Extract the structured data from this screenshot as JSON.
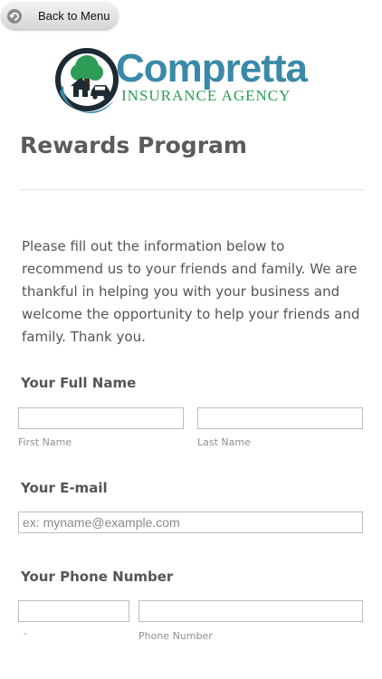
{
  "nav": {
    "back_label": "Back to Menu"
  },
  "logo": {
    "name": "Compretta",
    "tagline": "INSURANCE AGENCY"
  },
  "page": {
    "title": "Rewards Program",
    "intro": "Please fill out the information below to recommend us to your friends and family. We are thankful in helping you with your business and welcome the opportunity to help your friends and family. Thank you."
  },
  "form": {
    "full_name": {
      "label": "Your Full Name",
      "first_sublabel": "First Name",
      "last_sublabel": "Last Name",
      "first_value": "",
      "last_value": ""
    },
    "email": {
      "label": "Your E-mail",
      "placeholder": "ex: myname@example.com",
      "value": ""
    },
    "phone": {
      "label": "Your Phone Number",
      "area_sublabel": "-",
      "number_sublabel": "Phone Number",
      "area_value": "",
      "number_value": ""
    }
  },
  "colors": {
    "brand_blue": "#3a89a8",
    "brand_green": "#2e9c57",
    "logo_dark": "#1d2a33"
  }
}
